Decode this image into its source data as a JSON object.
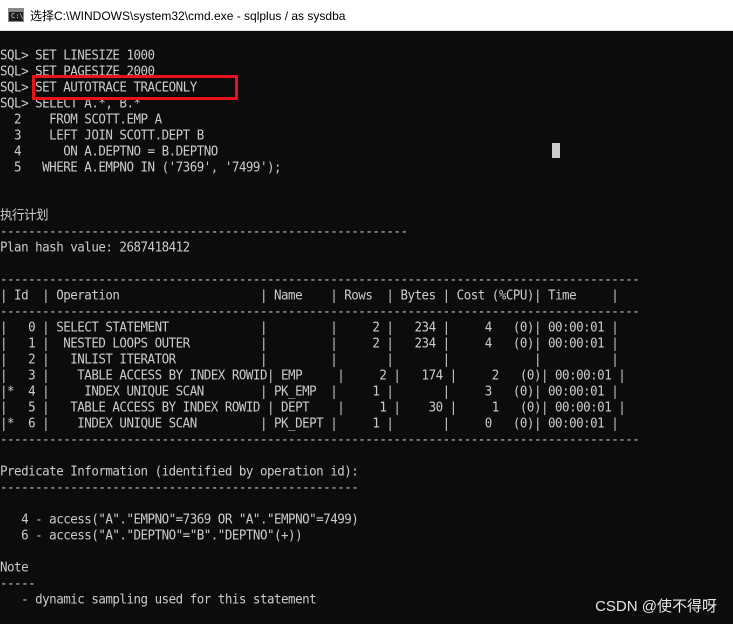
{
  "window": {
    "title": "选择C:\\WINDOWS\\system32\\cmd.exe - sqlplus  / as sysdba",
    "icon_label": "C:\\"
  },
  "terminal": {
    "lines": [
      "SQL> SET LINESIZE 1000",
      "SQL> SET PAGESIZE 2000",
      "SQL> SET AUTOTRACE TRACEONLY",
      "SQL> SELECT A.*, B.*",
      "  2    FROM SCOTT.EMP A",
      "  3    LEFT JOIN SCOTT.DEPT B",
      "  4      ON A.DEPTNO = B.DEPTNO",
      "  5   WHERE A.EMPNO IN ('7369', '7499');",
      "",
      "",
      "执行计划",
      "----------------------------------------------------------",
      "Plan hash value: 2687418412",
      "",
      "-------------------------------------------------------------------------------------------",
      "| Id  | Operation                    | Name    | Rows  | Bytes | Cost (%CPU)| Time     |",
      "-------------------------------------------------------------------------------------------",
      "|   0 | SELECT STATEMENT             |         |     2 |   234 |     4   (0)| 00:00:01 |",
      "|   1 |  NESTED LOOPS OUTER          |         |     2 |   234 |     4   (0)| 00:00:01 |",
      "|   2 |   INLIST ITERATOR            |         |       |       |            |          |",
      "|   3 |    TABLE ACCESS BY INDEX ROWID| EMP     |     2 |   174 |     2   (0)| 00:00:01 |",
      "|*  4 |     INDEX UNIQUE SCAN        | PK_EMP  |     1 |       |     3   (0)| 00:00:01 |",
      "|   5 |   TABLE ACCESS BY INDEX ROWID | DEPT    |     1 |    30 |     1   (0)| 00:00:01 |",
      "|*  6 |    INDEX UNIQUE SCAN         | PK_DEPT |     1 |       |     0   (0)| 00:00:01 |",
      "-------------------------------------------------------------------------------------------",
      "",
      "Predicate Information (identified by operation id):",
      "---------------------------------------------------",
      "",
      "   4 - access(\"A\".\"EMPNO\"=7369 OR \"A\".\"EMPNO\"=7499)",
      "   6 - access(\"A\".\"DEPTNO\"=\"B\".\"DEPTNO\"(+))",
      "",
      "Note",
      "-----",
      "   - dynamic sampling used for this statement"
    ]
  },
  "watermark": "CSDN @使不得呀",
  "colors": {
    "background": "#0c0c0c",
    "text": "#cccccc",
    "highlight": "#e8141b"
  }
}
